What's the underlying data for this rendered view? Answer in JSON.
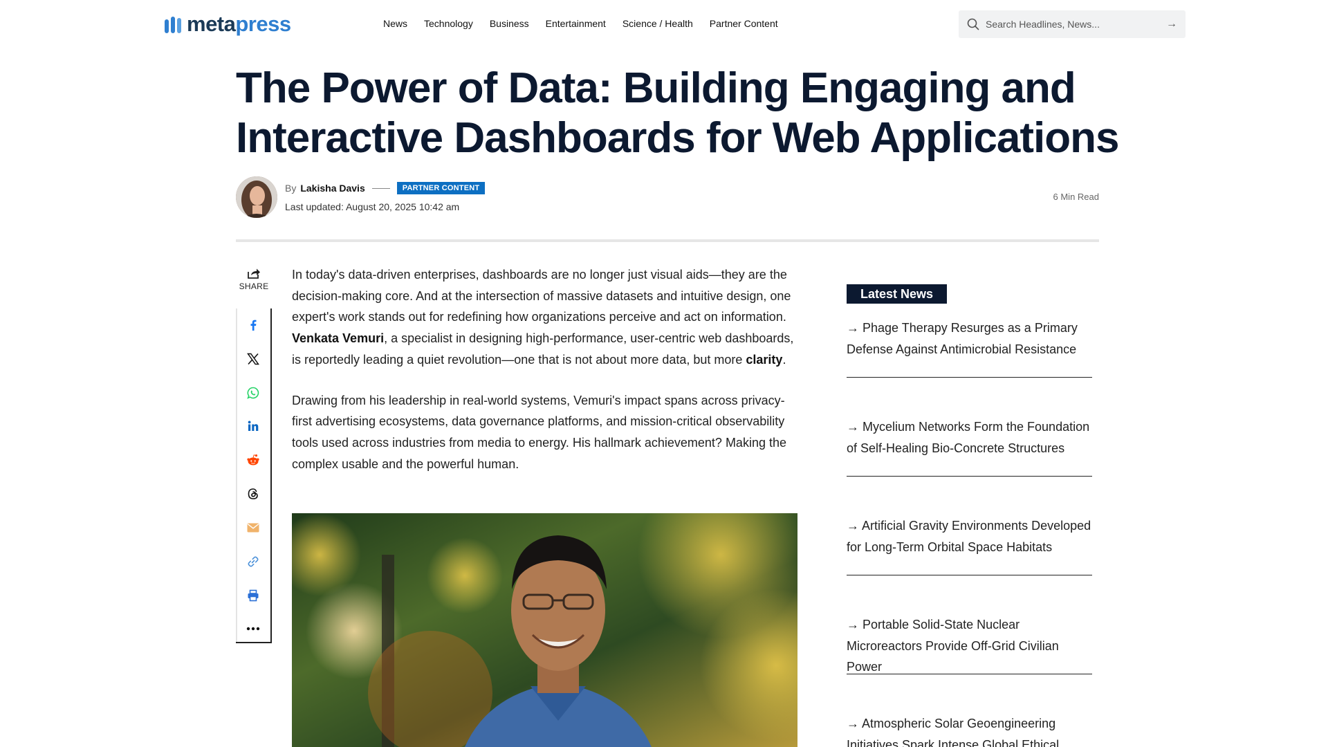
{
  "header": {
    "logo": {
      "part1": "meta",
      "part2": "press"
    },
    "nav": [
      "News",
      "Technology",
      "Business",
      "Entertainment",
      "Science / Health",
      "Partner Content"
    ],
    "search": {
      "placeholder": "Search Headlines, News..."
    }
  },
  "article": {
    "title": "The Power of Data: Building Engaging and Interactive Dashboards for Web Applications",
    "by_prefix": "By",
    "author": "Lakisha Davis",
    "badge": "PARTNER CONTENT",
    "updated": "Last updated: August 20, 2025 10:42 am",
    "read_time": "6 Min Read",
    "share_label": "SHARE",
    "paragraph1": {
      "part1": "In today's data-driven enterprises, dashboards are no longer just visual aids—they are the decision-making core. And at the intersection of massive datasets and intuitive design, one expert's work stands out for redefining how organizations perceive and act on information. ",
      "bold1": "Venkata Vemuri",
      "part2": ", a specialist in designing high-performance, user-centric web dashboards, is reportedly leading a quiet revolution—one that is not about more data, but more ",
      "bold2": "clarity",
      "part3": "."
    },
    "paragraph2": "Drawing from his leadership in real-world systems, Vemuri's impact spans across privacy-first advertising ecosystems, data governance platforms, and mission-critical observability tools used across industries from media to energy. His hallmark achievement? Making the complex usable and the powerful human."
  },
  "share_icons": [
    "facebook-icon",
    "x-icon",
    "whatsapp-icon",
    "linkedin-icon",
    "reddit-icon",
    "threads-icon",
    "email-icon",
    "link-icon",
    "print-icon",
    "more-icon"
  ],
  "sidebar": {
    "heading": "Latest News",
    "items": [
      "→ Phage Therapy Resurges as a Primary Defense Against Antimicrobial Resistance",
      "→ Mycelium Networks Form the Foundation of Self-Healing Bio-Concrete Structures",
      "→ Artificial Gravity Environments Developed for Long-Term Orbital Space Habitats",
      "→ Portable Solid-State Nuclear Microreactors Provide Off-Grid Civilian Power",
      "→ Atmospheric Solar Geoengineering Initiatives Spark Intense Global Ethical Debate"
    ]
  },
  "colors": {
    "brand_dark": "#1b3a57",
    "brand_light": "#2f7fd0",
    "title": "#0c1930",
    "badge": "#0d6fc2"
  }
}
